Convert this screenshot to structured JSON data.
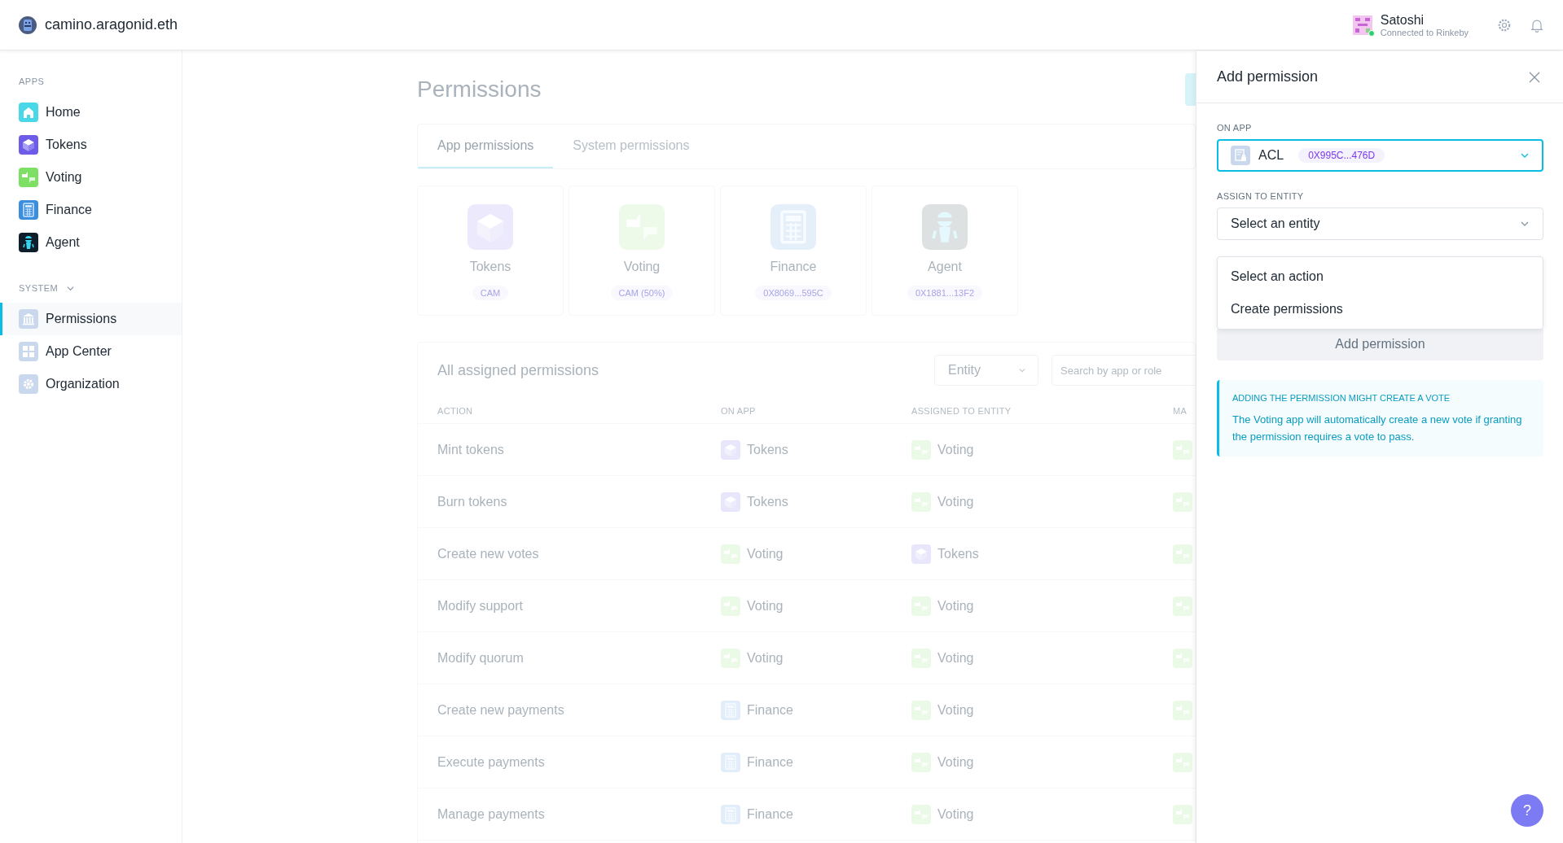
{
  "header": {
    "org": "camino.aragonid.eth",
    "user": {
      "name": "Satoshi",
      "network": "Connected to Rinkeby",
      "online": true
    }
  },
  "sidebar": {
    "sections": [
      {
        "label": "APPS",
        "kind": "plain",
        "items": [
          {
            "label": "Home",
            "kind": "home",
            "selected": false
          },
          {
            "label": "Tokens",
            "kind": "tokens",
            "selected": false
          },
          {
            "label": "Voting",
            "kind": "voting",
            "selected": false
          },
          {
            "label": "Finance",
            "kind": "finance",
            "selected": false
          },
          {
            "label": "Agent",
            "kind": "agent",
            "selected": false
          }
        ]
      },
      {
        "label": "SYSTEM",
        "kind": "collapsible",
        "expanded": true,
        "items": [
          {
            "label": "Permissions",
            "kind": "permissions",
            "selected": true
          },
          {
            "label": "App Center",
            "kind": "appcenter",
            "selected": false
          },
          {
            "label": "Organization",
            "kind": "organization",
            "selected": false
          }
        ]
      }
    ]
  },
  "main": {
    "title": "Permissions",
    "tabs": [
      {
        "label": "App permissions",
        "selected": true
      },
      {
        "label": "System permissions",
        "selected": false
      }
    ],
    "app_cards": [
      {
        "name": "Tokens",
        "kind": "tokens",
        "badge": "CAM"
      },
      {
        "name": "Voting",
        "kind": "voting",
        "badge": "CAM (50%)"
      },
      {
        "name": "Finance",
        "kind": "finance",
        "badge": "0X8069...595C"
      },
      {
        "name": "Agent",
        "kind": "agent",
        "badge": "0X1881...13F2"
      }
    ],
    "table": {
      "title": "All assigned permissions",
      "filter": "Entity",
      "search": {
        "placeholder": "Search by app or role"
      },
      "columns": [
        "ACTION",
        "ON APP",
        "ASSIGNED TO ENTITY",
        "MA"
      ],
      "rows": [
        {
          "action": "Mint tokens",
          "app": {
            "name": "Tokens",
            "kind": "tokens"
          },
          "entity": {
            "name": "Voting",
            "kind": "voting"
          },
          "column_4": {
            "kind": "voting"
          }
        },
        {
          "action": "Burn tokens",
          "app": {
            "name": "Tokens",
            "kind": "tokens"
          },
          "entity": {
            "name": "Voting",
            "kind": "voting"
          },
          "column_4": {
            "kind": "voting"
          }
        },
        {
          "action": "Create new votes",
          "app": {
            "name": "Voting",
            "kind": "voting"
          },
          "entity": {
            "name": "Tokens",
            "kind": "tokens"
          },
          "column_4": {
            "kind": "voting"
          }
        },
        {
          "action": "Modify support",
          "app": {
            "name": "Voting",
            "kind": "voting"
          },
          "entity": {
            "name": "Voting",
            "kind": "voting"
          },
          "column_4": {
            "kind": "voting"
          }
        },
        {
          "action": "Modify quorum",
          "app": {
            "name": "Voting",
            "kind": "voting"
          },
          "entity": {
            "name": "Voting",
            "kind": "voting"
          },
          "column_4": {
            "kind": "voting"
          }
        },
        {
          "action": "Create new payments",
          "app": {
            "name": "Finance",
            "kind": "finance"
          },
          "entity": {
            "name": "Voting",
            "kind": "voting"
          },
          "column_4": {
            "kind": "voting"
          }
        },
        {
          "action": "Execute payments",
          "app": {
            "name": "Finance",
            "kind": "finance"
          },
          "entity": {
            "name": "Voting",
            "kind": "voting"
          },
          "column_4": {
            "kind": "voting"
          }
        },
        {
          "action": "Manage payments",
          "app": {
            "name": "Finance",
            "kind": "finance"
          },
          "entity": {
            "name": "Voting",
            "kind": "voting"
          },
          "column_4": {
            "kind": "voting"
          }
        }
      ]
    }
  },
  "panel": {
    "title": "Add permission",
    "on_app": {
      "label": "ON APP",
      "value": "ACL",
      "kind": "acl",
      "badge": "0X995C...476D",
      "focused": true
    },
    "entity": {
      "label": "ASSIGN TO ENTITY",
      "placeholder": "Select an entity"
    },
    "action_menu": {
      "options": [
        "Select an action",
        "Create permissions"
      ]
    },
    "submit": {
      "label": "Add permission",
      "disabled": true
    },
    "notice": {
      "title": "ADDING THE PERMISSION MIGHT CREATE A VOTE",
      "text": "The Voting app will automatically create a new vote if granting the permission requires a vote to pass."
    }
  },
  "help_button": {
    "label": "?"
  }
}
